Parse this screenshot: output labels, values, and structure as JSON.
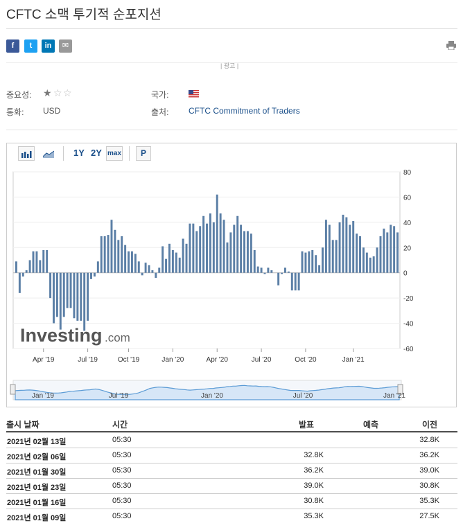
{
  "page": {
    "title": "CFTC 소맥 투기적 순포지션",
    "ad_label": "| 광고 |"
  },
  "share": {
    "facebook": "f",
    "twitter": "t",
    "linkedin": "in",
    "email": "✉"
  },
  "info": {
    "importance_label": "중요성:",
    "importance_stars": 1,
    "country_label": "국가:",
    "currency_label": "통화:",
    "currency_value": "USD",
    "source_label": "출처:",
    "source_value": "CFTC Commitment of Traders"
  },
  "toolbar": {
    "r1y": "1Y",
    "r2y": "2Y",
    "rmax": "max",
    "p": "P"
  },
  "watermark": {
    "brand": "Investing",
    "suffix": ".com"
  },
  "chart_data": {
    "type": "bar",
    "ylim": [
      -60,
      80
    ],
    "yticks": [
      80,
      60,
      40,
      20,
      0,
      -20,
      -40,
      -60
    ],
    "xtick_labels": [
      "Apr '19",
      "Jul '19",
      "Oct '19",
      "Jan '20",
      "Apr '20",
      "Jul '20",
      "Oct '20",
      "Jan '21"
    ],
    "navigator_labels": [
      "Jan '19",
      "Jul '19",
      "Jan '20",
      "Jul '20",
      "Jan '21"
    ],
    "color": "#5b7fa6",
    "values": [
      9,
      -16,
      -3,
      2,
      10,
      17,
      17,
      10,
      18,
      18,
      -20,
      -40,
      -35,
      -45,
      -35,
      -28,
      -28,
      -36,
      -38,
      -38,
      -46,
      -38,
      -5,
      -3,
      9,
      29,
      29,
      30,
      42,
      34,
      26,
      29,
      22,
      17,
      17,
      15,
      9,
      -2,
      8,
      6,
      2,
      -4,
      4,
      21,
      11,
      23,
      18,
      16,
      12,
      27,
      23,
      39,
      39,
      33,
      37,
      45,
      39,
      47,
      40,
      62,
      47,
      42,
      24,
      32,
      38,
      45,
      38,
      33,
      33,
      31,
      18,
      5,
      4,
      -1,
      4,
      2,
      0,
      -10,
      -1,
      4,
      1,
      -14,
      -14,
      -14,
      17,
      16,
      17,
      18,
      14,
      6,
      20,
      42,
      38,
      26,
      26,
      40,
      46,
      44,
      38,
      41,
      31,
      29,
      20,
      16,
      12,
      13,
      20,
      29,
      35,
      32,
      38,
      37,
      32
    ],
    "x_ticks_index": [
      8,
      21,
      33,
      46,
      59,
      72,
      85,
      99
    ]
  },
  "table": {
    "headers": {
      "date": "출시 날짜",
      "time": "시간",
      "actual": "발표",
      "forecast": "예측",
      "previous": "이전"
    },
    "rows": [
      {
        "date": "2021년 02월 13일",
        "time": "05:30",
        "actual": "",
        "forecast": "",
        "previous": "32.8K"
      },
      {
        "date": "2021년 02월 06일",
        "time": "05:30",
        "actual": "32.8K",
        "forecast": "",
        "previous": "36.2K"
      },
      {
        "date": "2021년 01월 30일",
        "time": "05:30",
        "actual": "36.2K",
        "forecast": "",
        "previous": "39.0K"
      },
      {
        "date": "2021년 01월 23일",
        "time": "05:30",
        "actual": "39.0K",
        "forecast": "",
        "previous": "30.8K"
      },
      {
        "date": "2021년 01월 16일",
        "time": "05:30",
        "actual": "30.8K",
        "forecast": "",
        "previous": "35.3K"
      },
      {
        "date": "2021년 01월 09일",
        "time": "05:30",
        "actual": "35.3K",
        "forecast": "",
        "previous": "27.5K"
      }
    ]
  }
}
